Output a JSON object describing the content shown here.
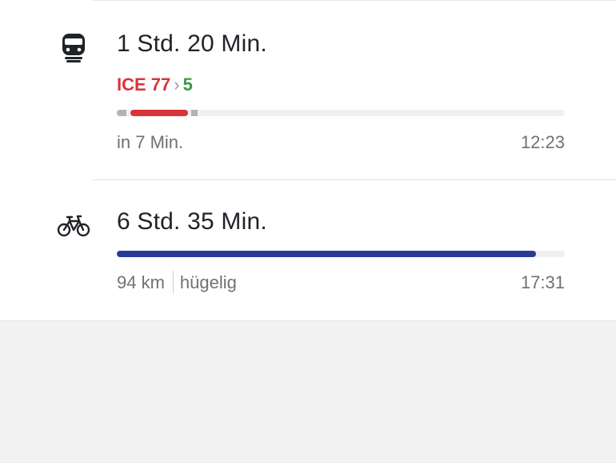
{
  "routes": [
    {
      "mode_icon": "train-icon",
      "duration": "1 Std. 20 Min.",
      "lines": {
        "first": "ICE 77",
        "chevron": "›",
        "second": "5"
      },
      "departure": "in 7 Min.",
      "arrival": "12:23"
    },
    {
      "mode_icon": "bicycle-icon",
      "duration": "6 Std. 35 Min.",
      "distance": "94 km",
      "terrain": "hügelig",
      "arrival": "17:31"
    }
  ],
  "colors": {
    "ice_line": "#d8353b",
    "bus_line": "#3a9a43",
    "bike_bar": "#2a3b96",
    "walk_bar": "#b3b3b3"
  }
}
